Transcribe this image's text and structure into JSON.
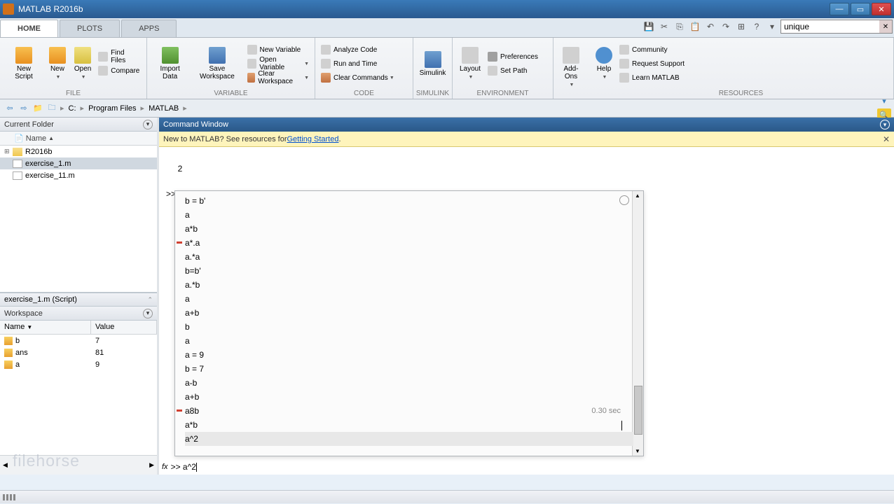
{
  "title": "MATLAB R2016b",
  "tabs": {
    "home": "HOME",
    "plots": "PLOTS",
    "apps": "APPS"
  },
  "search": {
    "value": "unique"
  },
  "ribbon": {
    "file": {
      "label": "FILE",
      "new_script": "New\nScript",
      "new": "New",
      "open": "Open",
      "find_files": "Find Files",
      "compare": "Compare"
    },
    "variable": {
      "label": "VARIABLE",
      "import_data": "Import\nData",
      "save_ws": "Save\nWorkspace",
      "new_var": "New Variable",
      "open_var": "Open Variable",
      "clear_ws": "Clear Workspace"
    },
    "code": {
      "label": "CODE",
      "analyze": "Analyze Code",
      "runtime": "Run and Time",
      "clear_cmd": "Clear Commands"
    },
    "simulink": {
      "label": "SIMULINK",
      "btn": "Simulink"
    },
    "env": {
      "label": "ENVIRONMENT",
      "layout": "Layout",
      "prefs": "Preferences",
      "setpath": "Set Path"
    },
    "addons": "Add-Ons",
    "help": "Help",
    "resources": {
      "label": "RESOURCES",
      "community": "Community",
      "support": "Request Support",
      "learn": "Learn MATLAB"
    }
  },
  "path": {
    "c": "C:",
    "pf": "Program Files",
    "matlab": "MATLAB"
  },
  "current_folder": {
    "title": "Current Folder",
    "name_col": "Name",
    "items": [
      {
        "name": "R2016b",
        "is_folder": true
      },
      {
        "name": "exercise_1.m",
        "selected": true
      },
      {
        "name": "exercise_11.m"
      }
    ]
  },
  "detail": "exercise_1.m  (Script)",
  "workspace": {
    "title": "Workspace",
    "cols": {
      "name": "Name",
      "value": "Value"
    },
    "vars": [
      {
        "name": "b",
        "value": "7"
      },
      {
        "name": "ans",
        "value": "81"
      },
      {
        "name": "a",
        "value": "9"
      }
    ]
  },
  "cmd": {
    "title": "Command Window",
    "msg_prefix": "New to MATLAB? See resources for ",
    "msg_link": "Getting Started",
    "msg_suffix": ".",
    "out2": "     2",
    "line_ab": ">> a+b",
    "history": {
      "l0": "b = b'",
      "l1": "a",
      "l2": "a*b",
      "l3": "a*.a",
      "l4": "a.*a",
      "l5": "b=b'",
      "l6": "a.*b",
      "l7": "a",
      "l8": "a+b",
      "l9": "b",
      "l10": "a",
      "l11": "a = 9",
      "l12": "b = 7",
      "l13": "a-b",
      "l14": "a+b",
      "l15": "a8b",
      "l16": "a*b",
      "l17": "a^2",
      "time": "0.30 sec"
    },
    "prompt": ">> a^2"
  },
  "watermark": "filehorse"
}
